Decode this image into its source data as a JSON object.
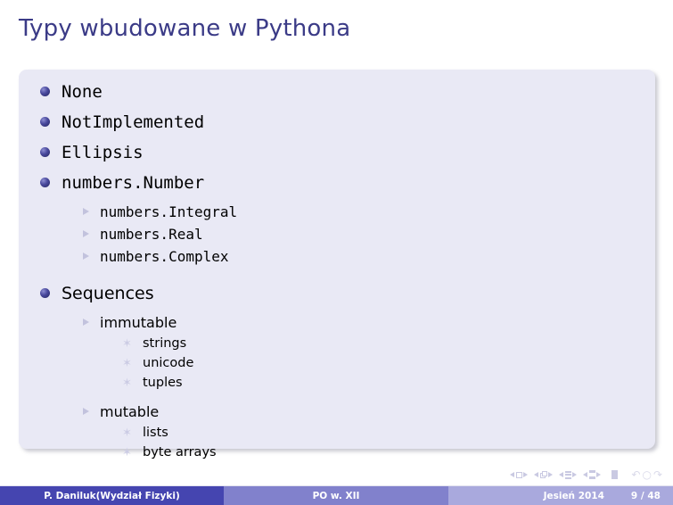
{
  "slide": {
    "title": "Typy wbudowane w Pythona",
    "title_color": "#3b3b87",
    "block_bg": "#e9e9f5"
  },
  "content": {
    "items": [
      {
        "level": 1,
        "bullet": "ball-bullet-icon",
        "font": "mono",
        "label": "None"
      },
      {
        "level": 1,
        "bullet": "ball-bullet-icon",
        "font": "mono",
        "label": "NotImplemented"
      },
      {
        "level": 1,
        "bullet": "ball-bullet-icon",
        "font": "mono",
        "label": "Ellipsis"
      },
      {
        "level": 1,
        "bullet": "ball-bullet-icon",
        "font": "mono",
        "label": "numbers.Number"
      },
      {
        "level": 2,
        "bullet": "triangle-bullet-icon",
        "font": "mono",
        "label": "numbers.Integral"
      },
      {
        "level": 2,
        "bullet": "triangle-bullet-icon",
        "font": "mono",
        "label": "numbers.Real"
      },
      {
        "level": 2,
        "bullet": "triangle-bullet-icon",
        "font": "mono",
        "label": "numbers.Complex"
      },
      {
        "level": 1,
        "bullet": "ball-bullet-icon",
        "font": "sans",
        "label": "Sequences"
      },
      {
        "level": 2,
        "bullet": "triangle-bullet-icon",
        "font": "sans",
        "label": "immutable"
      },
      {
        "level": 3,
        "bullet": "star-bullet-icon",
        "font": "sans",
        "label": "strings"
      },
      {
        "level": 3,
        "bullet": "star-bullet-icon",
        "font": "sans",
        "label": "unicode"
      },
      {
        "level": 3,
        "bullet": "star-bullet-icon",
        "font": "sans",
        "label": "tuples"
      },
      {
        "level": 2,
        "bullet": "triangle-bullet-icon",
        "font": "sans",
        "label": "mutable"
      },
      {
        "level": 3,
        "bullet": "star-bullet-icon",
        "font": "sans",
        "label": "lists"
      },
      {
        "level": 3,
        "bullet": "star-bullet-icon",
        "font": "sans",
        "label": "byte arrays"
      }
    ]
  },
  "navigation": {
    "symbols": [
      "slide-prev-icon",
      "slide-icon",
      "slide-next-icon",
      "frame-prev-icon",
      "frame-icon",
      "frame-next-icon",
      "subsection-prev-icon",
      "subsection-icon",
      "subsection-next-icon",
      "section-prev-icon",
      "section-icon",
      "section-next-icon",
      "doc-icon",
      "back-icon",
      "search-icon",
      "forward-icon"
    ],
    "star_glyph": "✶",
    "arc_back": "↶",
    "arc_search": "○",
    "arc_forward": "↷"
  },
  "footer": {
    "author": "P. Daniluk(Wydział Fizyki)",
    "talk": "PO w. XII",
    "date": "Jesień 2014",
    "page": "9 / 48",
    "colors": {
      "author_bg": "#4545b0",
      "talk_bg": "#8181cc",
      "date_bg": "#a9a9dd"
    }
  }
}
